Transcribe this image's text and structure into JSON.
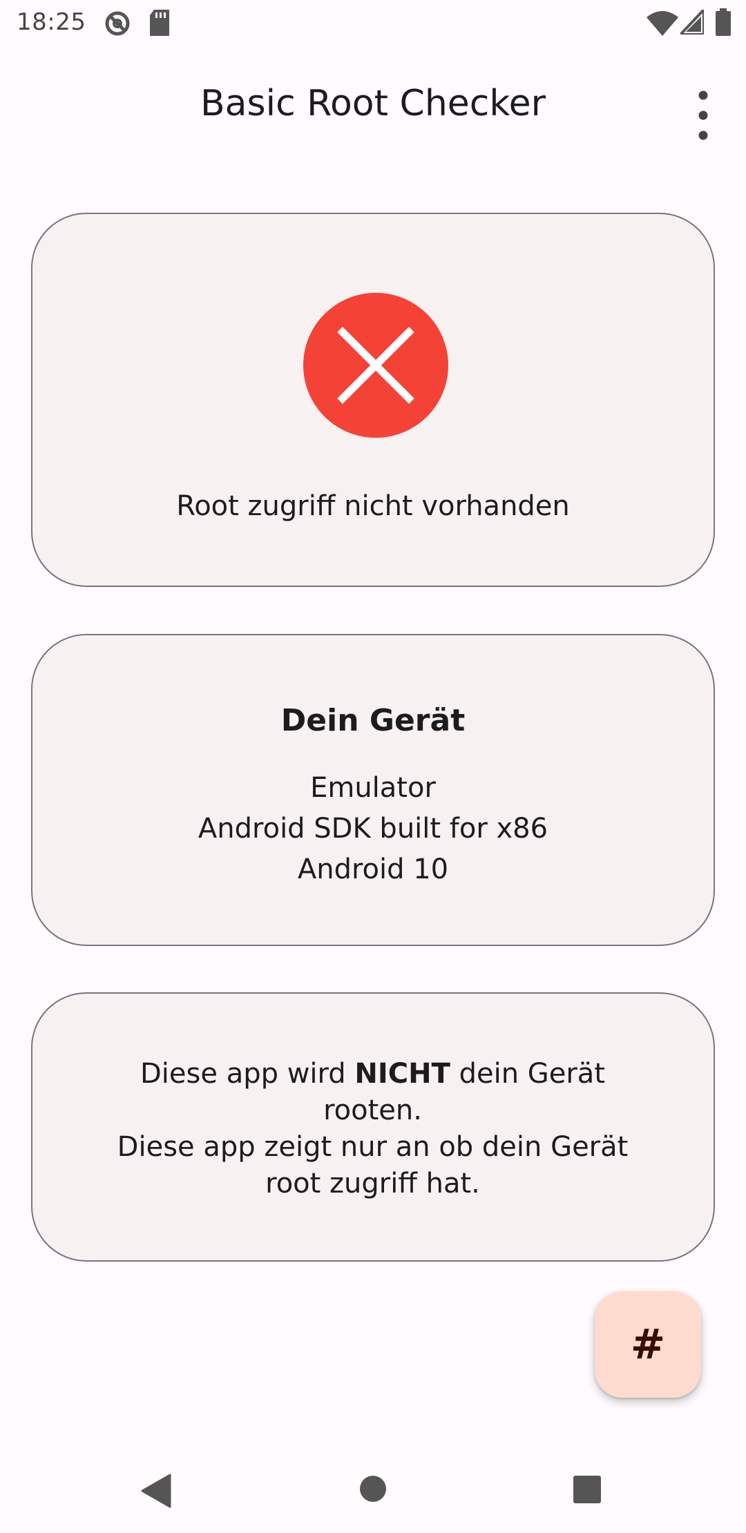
{
  "status_bar": {
    "time": "18:25",
    "icons": [
      "at-sign-icon",
      "sd-card-icon",
      "wifi-icon",
      "signal-icon",
      "battery-icon"
    ]
  },
  "app_bar": {
    "title": "Basic Root Checker",
    "menu_icon": "overflow-menu-icon"
  },
  "root_status": {
    "icon": "error-circle-icon",
    "icon_color": "#f44336",
    "message": "Root zugriff nicht vorhanden"
  },
  "device": {
    "title": "Dein Gerät",
    "type": "Emulator",
    "model": "Android SDK built for x86",
    "android_version": "Android 10"
  },
  "info": {
    "part1": "Diese app wird ",
    "emphasis": "NICHT",
    "part2": " dein Gerät rooten.",
    "line2": "Diese app zeigt nur an ob dein Gerät root zugriff hat."
  },
  "fab": {
    "glyph": "#",
    "icon": "hash-icon",
    "background": "#ffdbcf"
  },
  "nav_bar": {
    "icons": [
      "back-triangle-icon",
      "home-circle-icon",
      "recents-square-icon"
    ]
  },
  "colors": {
    "card_background": "#f8f1f1",
    "card_border": "#79747e",
    "page_background": "#fffbfe"
  }
}
